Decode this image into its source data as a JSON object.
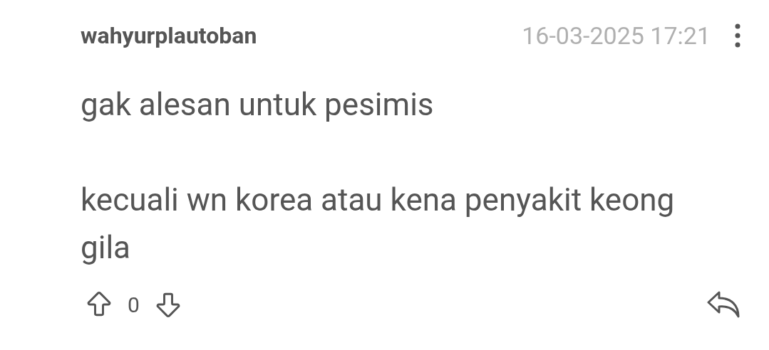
{
  "comment": {
    "author": "wahyurplautoban",
    "timestamp": "16-03-2025 17:21",
    "paragraphs": [
      "gak alesan untuk pesimis",
      "kecuali wn korea atau kena penyakit keong gila"
    ],
    "vote_count": "0"
  }
}
